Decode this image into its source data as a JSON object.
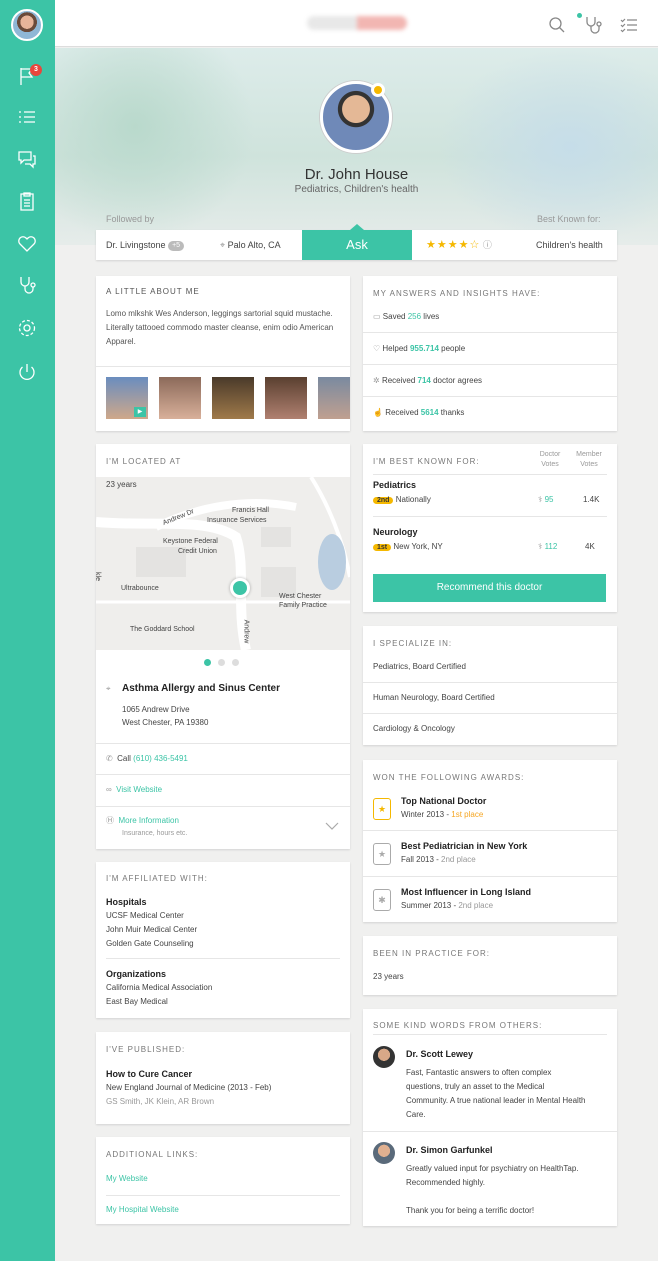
{
  "sidebar": {
    "notif_count": "3"
  },
  "header": {
    "icons": [
      "search-icon",
      "stethoscope-icon",
      "checklist-icon"
    ]
  },
  "profile": {
    "name": "Dr. John House",
    "specialty": "Pediatrics, Children's health",
    "followed_by_label": "Followed by",
    "best_known_label": "Best Known for:",
    "follower": "Dr. Livingstone",
    "follower_more": "+5",
    "location": "Palo Alto, CA",
    "ask": "Ask",
    "rating": 4,
    "rating_max": 5,
    "known_for": "Children's health"
  },
  "about": {
    "title": "A LITTLE ABOUT ME",
    "text": "Lomo mlkshk Wes Anderson, leggings sartorial squid mustache. Literally tattooed commodo master cleanse, enim odio American Apparel."
  },
  "insights": {
    "title": "MY ANSWERS AND INSIGHTS HAVE:",
    "items": [
      {
        "pre": "Saved ",
        "val": "256",
        "post": " lives"
      },
      {
        "pre": "Helped ",
        "val": "955.714",
        "post": " people"
      },
      {
        "pre": "Received ",
        "val": "714",
        "post": " doctor agrees"
      },
      {
        "pre": "Received ",
        "val": "5614",
        "post": " thanks"
      }
    ]
  },
  "located": {
    "title": "I'M LOCATED AT",
    "map_labels": {
      "years": "23 years",
      "francis": "Francis Hall",
      "insurance": "Insurance Services",
      "andrew1": "Andrew Dr",
      "keystone": "Keystone Federal",
      "credit": "Credit Union",
      "ultrabounce": "Ultrabounce",
      "westchester": "West Chester",
      "family": "Family Practice",
      "goddard": "The Goddard School",
      "andrew2": "Andrew",
      "kle": "kle"
    },
    "name": "Asthma Allergy and Sinus Center",
    "addr1": "1065 Andrew Drive",
    "addr2": "West Chester, PA 19380",
    "call_label": "Call ",
    "phone": "(610) 436-5491",
    "website": "Visit Website",
    "more": "More Information",
    "more_sub": "Insurance, hours etc."
  },
  "best_known": {
    "title": "I'M BEST KNOWN FOR:",
    "col1a": "Doctor",
    "col1b": "Votes",
    "col2a": "Member",
    "col2b": "Votes",
    "items": [
      {
        "name": "Pediatrics",
        "rank": "2nd",
        "scope": "Nationally",
        "doctor_votes": "95",
        "member_votes": "1.4K"
      },
      {
        "name": "Neurology",
        "rank": "1st",
        "scope": "New York, NY",
        "doctor_votes": "112",
        "member_votes": "4K"
      }
    ],
    "button": "Recommend this doctor"
  },
  "specialize": {
    "title": "I SPECIALIZE IN:",
    "items": [
      "Pediatrics, Board Certified",
      "Human Neurology, Board Certified",
      "Cardiology & Oncology"
    ]
  },
  "affiliated": {
    "title": "I'M AFFILIATED WITH:",
    "hospitals_label": "Hospitals",
    "hospitals": [
      "UCSF Medical Center",
      "John Muir Medical Center",
      "Golden Gate Counseling"
    ],
    "orgs_label": "Organizations",
    "orgs": [
      "California Medical Association",
      "East Bay Medical"
    ]
  },
  "awards": {
    "title": "WON THE FOLLOWING AWARDS:",
    "items": [
      {
        "name": "Top National Doctor",
        "meta": "Winter 2013 - ",
        "place": "1st place"
      },
      {
        "name": "Best Pediatrician in New York",
        "meta": "Fall 2013 - ",
        "place": "2nd place"
      },
      {
        "name": "Most Influencer in Long Island",
        "meta": "Summer 2013 - ",
        "place": "2nd place"
      }
    ]
  },
  "practice": {
    "title": "BEEN IN PRACTICE FOR:",
    "years": "23 years"
  },
  "published": {
    "title": "I'VE PUBLISHED:",
    "name": "How to Cure Cancer",
    "journal": "New England Journal of Medicine (2013 - Feb)",
    "authors": "GS Smith, JK Klein, AR Brown"
  },
  "links": {
    "title": "ADDITIONAL LINKS:",
    "items": [
      "My Website",
      "My Hospital Website"
    ]
  },
  "kind": {
    "title": "SOME KIND WORDS FROM OTHERS:",
    "items": [
      {
        "name": "Dr. Scott Lewey",
        "text": [
          "Fast, Fantastic answers to often complex",
          "questions, truly an asset to the Medical",
          "Community. A true national leader in Mental Health",
          "Care."
        ]
      },
      {
        "name": "Dr. Simon Garfunkel",
        "text": [
          "Greatly valued input for psychiatry on HealthTap.",
          "Recommended highly.",
          "",
          "Thank you for being a terrific doctor!"
        ]
      }
    ]
  }
}
